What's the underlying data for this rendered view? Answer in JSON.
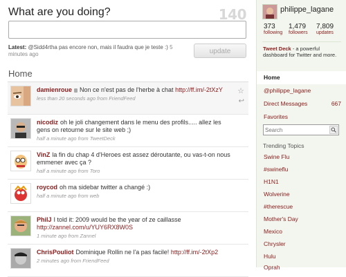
{
  "composer": {
    "prompt": "What are you doing?",
    "counter": "140",
    "input_value": "",
    "latest_label": "Latest:",
    "latest_text": "@Sidd4rtha pas encore non, mais il faudra que je teste :)",
    "latest_time": "5 minutes ago",
    "update_label": "update"
  },
  "home_title": "Home",
  "tweets": [
    {
      "user": "damienroue",
      "text": "Non ce n'est pas de l'herbe à chat",
      "link": "http://ff.im/-2tXzY",
      "meta": "less than 20 seconds ago from FriendFeed",
      "protected": true
    },
    {
      "user": "nicodiz",
      "text": "oh le joli changement dans le menu des profils..... allez les gens on retourne sur le site web ;)",
      "link": "",
      "meta": "half a minute ago from TweetDeck"
    },
    {
      "user": "VinZ",
      "text": "la fin du chap 4 d'Heroes est assez déroutante, ou vas-t-on nous emmener avec ça ?",
      "link": "",
      "meta": "half a minute ago from Toro"
    },
    {
      "user": "roycod",
      "text": "oh ma sidebar twitter a changé :)",
      "link": "",
      "meta": "half a minute ago from web"
    },
    {
      "user": "PhilJ",
      "text": "I told it: 2009 would be the year of ze caillasse",
      "link": "http://zannel.com/u/YUY6RX8W0S",
      "meta": "1 minute ago from Zannel"
    },
    {
      "user": "ChrisPouliot",
      "text": "Dominique Rollin ne l'a pas facile!",
      "link": "http://ff.im/-2tXp2",
      "meta": "2 minutes ago from FriendFeed"
    }
  ],
  "profile": {
    "name": "philippe_lagane",
    "stats": [
      {
        "value": "373",
        "label": "following"
      },
      {
        "value": "1,479",
        "label": "followers"
      },
      {
        "value": "7,809",
        "label": "updates"
      }
    ]
  },
  "ad": {
    "title": "Tweet Deck",
    "text": "- a powerful dashboard for Twitter and more."
  },
  "nav": [
    {
      "label": "Home",
      "count": ""
    },
    {
      "label": "@philippe_lagane",
      "count": ""
    },
    {
      "label": "Direct Messages",
      "count": "667"
    },
    {
      "label": "Favorites",
      "count": ""
    }
  ],
  "search": {
    "placeholder": "Search"
  },
  "trending": {
    "title": "Trending Topics",
    "items": [
      "Swine Flu",
      "#swineflu",
      "H1N1",
      "Wolverine",
      "#therescue",
      "Mother's Day",
      "Mexico",
      "Chrysler",
      "Hulu",
      "Oprah"
    ]
  },
  "colors": {
    "link": "#8b1a1a",
    "sidebar_bg": "#f2f6ee",
    "counter": "#d8d8d8"
  }
}
